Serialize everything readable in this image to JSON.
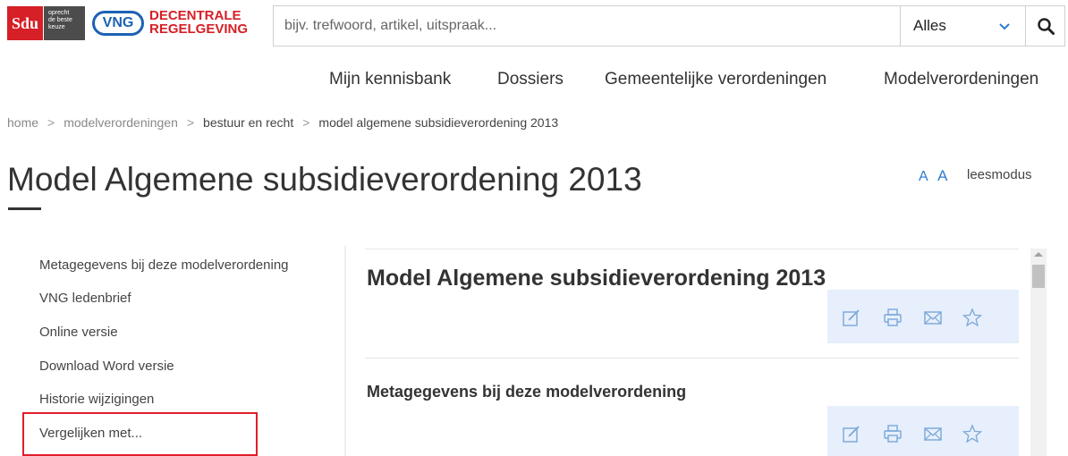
{
  "logos": {
    "sdu": "Sdu",
    "sdu_tagline": [
      "oprecht",
      "de beste",
      "keuze"
    ],
    "vng": "VNG",
    "vng_text": [
      "DECENTRALE",
      "REGELGEVING"
    ]
  },
  "search": {
    "placeholder": "bijv. trefwoord, artikel, uitspraak...",
    "scope": "Alles"
  },
  "nav": [
    "Mijn kennisbank",
    "Dossiers",
    "Gemeentelijke verordeningen",
    "Modelverordeningen"
  ],
  "breadcrumb": [
    "home",
    "modelverordeningen",
    "bestuur en recht",
    "model algemene subsidieverordening 2013"
  ],
  "page": {
    "title": "Model Algemene subsidieverordening 2013",
    "font_small": "A",
    "font_large": "A",
    "leesmodus": "leesmodus"
  },
  "sidebar": {
    "items": [
      {
        "label": "Metagegevens bij deze modelverordening"
      },
      {
        "label": "VNG ledenbrief"
      },
      {
        "label": "Online versie"
      },
      {
        "label": "Download Word versie"
      },
      {
        "label": "Historie wijzigingen"
      },
      {
        "label": "Vergelijken met..."
      }
    ]
  },
  "main": {
    "heading": "Model Algemene subsidieverordening 2013",
    "subheading": "Metagegevens bij deze modelverordening",
    "tools": [
      "edit-icon",
      "print-icon",
      "mail-icon",
      "star-icon"
    ]
  },
  "colors": {
    "brand_red": "#d61f26",
    "vng_blue": "#1c62b3",
    "accent_blue": "#2e7ad1",
    "toolbar_bg": "#e6effb",
    "highlight": "#e11d2a"
  }
}
